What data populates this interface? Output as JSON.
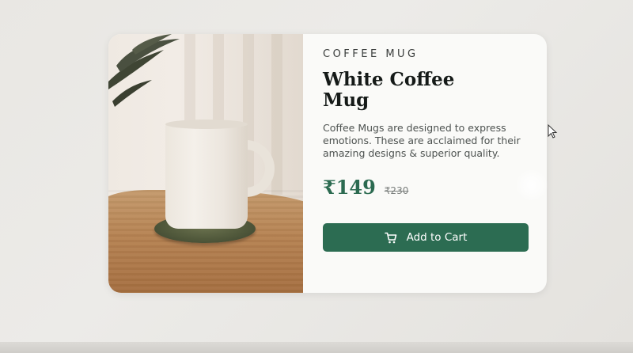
{
  "product": {
    "category": "COFFEE MUG",
    "title": "White Coffee Mug",
    "description": "Coffee Mugs are designed to express emotions. These are acclaimed for their amazing designs & superior quality.",
    "price": "₹149",
    "old_price": "₹230",
    "image_alt": "white coffee mug on coaster",
    "cart_button_label": "Add to Cart",
    "cart_icon": "cart-icon"
  },
  "colors": {
    "accent": "#2c6c52",
    "price": "#2b6a50",
    "card_bg": "#fafaf8"
  }
}
